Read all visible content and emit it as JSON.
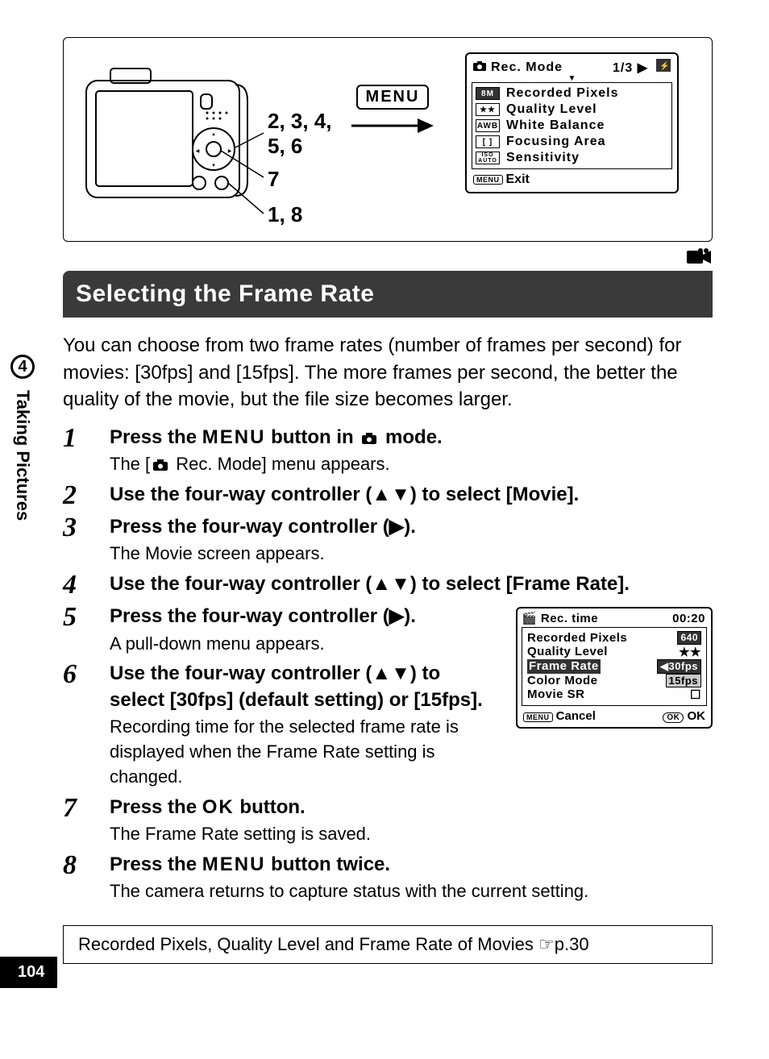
{
  "sidebar": {
    "chapter_number": "4",
    "chapter_label": "Taking Pictures"
  },
  "page_number": "104",
  "top_figure": {
    "callout_234_56": "2, 3, 4,\n5, 6",
    "callout_7": "7",
    "callout_18": "1, 8",
    "menu_label": "MENU",
    "screen": {
      "title": "Rec. Mode",
      "page": "1/3",
      "rows": [
        {
          "icon": "8M",
          "label": "Recorded Pixels"
        },
        {
          "icon": "★★",
          "label": "Quality Level"
        },
        {
          "icon": "AWB",
          "label": "White Balance"
        },
        {
          "icon": "[ ]",
          "label": "Focusing Area"
        },
        {
          "icon": "ISO AUTO",
          "label": "Sensitivity"
        }
      ],
      "exit_pill": "MENU",
      "exit_label": "Exit"
    }
  },
  "section_heading": "Selecting the Frame Rate",
  "intro": "You can choose from two frame rates (number of frames per second) for movies: [30fps] and [15fps]. The more frames per second, the better the quality of the movie, but the file size becomes larger.",
  "steps": {
    "s1": {
      "title_pre": "Press the ",
      "title_menu": "MENU",
      "title_mid": " button in ",
      "title_post": " mode.",
      "desc_pre": "The [",
      "desc_post": " Rec. Mode] menu appears."
    },
    "s2": {
      "title": "Use the four-way controller (▲▼) to select [Movie]."
    },
    "s3": {
      "title": "Press the four-way controller (▶).",
      "desc": "The Movie screen appears."
    },
    "s4": {
      "title": "Use the four-way controller (▲▼) to select [Frame Rate]."
    },
    "s5": {
      "title": "Press the four-way controller (▶).",
      "desc": "A pull-down menu appears."
    },
    "s6": {
      "title": "Use the four-way controller (▲▼) to select [30fps] (default setting) or [15fps].",
      "desc": "Recording time for the selected frame rate is displayed when the Frame Rate setting is changed."
    },
    "s7": {
      "title_pre": "Press the ",
      "title_ok": "OK",
      "title_post": " button.",
      "desc": "The Frame Rate setting is saved."
    },
    "s8": {
      "title_pre": "Press the ",
      "title_menu": "MENU",
      "title_post": " button twice.",
      "desc": "The camera returns to capture status with the current setting."
    }
  },
  "rec_time_screen": {
    "title": "Rec. time",
    "time": "00:20",
    "rows": {
      "recorded_pixels": {
        "label": "Recorded Pixels",
        "value": "640"
      },
      "quality_level": {
        "label": "Quality Level",
        "value": "★★"
      },
      "frame_rate": {
        "label": "Frame Rate",
        "value": "30fps"
      },
      "frame_rate_opt": {
        "value": "15fps"
      },
      "color_mode": {
        "label": "Color Mode"
      },
      "movie_sr": {
        "label": "Movie SR",
        "value": "☐"
      }
    },
    "cancel_pill": "MENU",
    "cancel_label": "Cancel",
    "ok_pill": "OK",
    "ok_label": "OK"
  },
  "crossref": {
    "text": "Recorded Pixels, Quality Level and Frame Rate of Movies ",
    "page": "☞p.30"
  }
}
